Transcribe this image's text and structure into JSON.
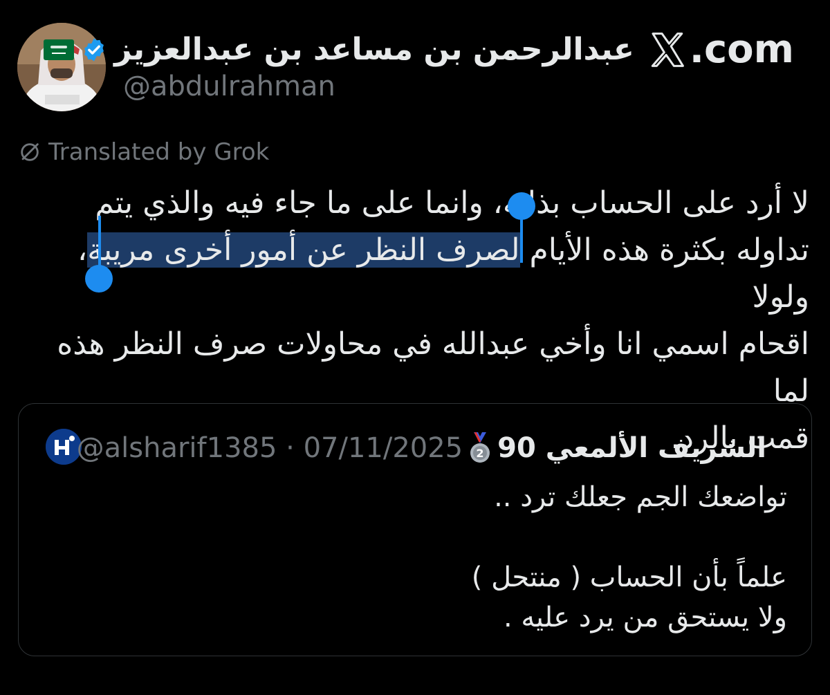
{
  "author": {
    "display_name": "عبدالرحمن بن مساعد بن عبدالعزيز",
    "handle": "@abdulrahman",
    "verified_icon": "verified-badge-icon",
    "flag_icon": "saudi-flag-icon"
  },
  "brand": {
    "label": ".com",
    "logo_icon": "x-logo-icon"
  },
  "translation": {
    "label": "Translated by Grok",
    "icon": "translate-icon"
  },
  "tweet": {
    "line1": "لا أرد على الحساب بذاته، وانما على ما جاء فيه والذي يتم",
    "line2_before": "تداوله بكثرة هذه الأيام ",
    "line2_selected": "لصرف النظر عن أمور أخرى مريبة",
    "line2_after": "، ولولا",
    "line3": "اقحام اسمي انا وأخي عبدالله في محاولات صرف النظر هذه لما",
    "line4": "قمت بالرد."
  },
  "quoted": {
    "display_name": "الشريف الألمعي 90",
    "medal_icon": "second-place-medal-icon",
    "meta": "@alsharif1385 · 07/11/2025",
    "text": "تواضعك الجم جعلك ترد  ..\n\nعلماً بأن الحساب ( منتحل )\nولا يستحق من يرد عليه ."
  },
  "colors": {
    "background": "#000000",
    "text": "#e7e9ea",
    "muted": "#71767b",
    "accent": "#1d9bf0",
    "selection": "#1d3b66"
  }
}
